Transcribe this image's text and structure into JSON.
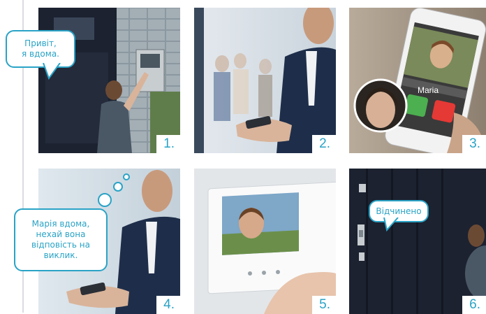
{
  "steps": [
    {
      "number": "1.",
      "bubble": "Привіт,\nя вдома."
    },
    {
      "number": "2."
    },
    {
      "number": "3.",
      "caller_name": "Maria"
    },
    {
      "number": "4.",
      "bubble": "Марія вдома,\nнехай вона\nвідповість на\nвиклик."
    },
    {
      "number": "5."
    },
    {
      "number": "6.",
      "bubble": "Відчинено"
    }
  ],
  "colors": {
    "accent": "#2aa3c6",
    "door": "#1c2230",
    "call_accept": "#4caf50",
    "call_decline": "#e53935"
  }
}
